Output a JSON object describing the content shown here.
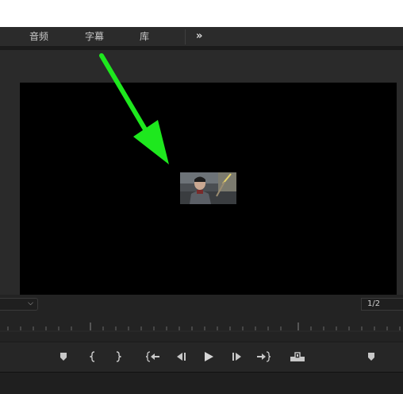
{
  "tabs": [
    {
      "label": "音频"
    },
    {
      "label": "字幕"
    },
    {
      "label": "库"
    }
  ],
  "overflow_label": "»",
  "monitor": {
    "page_indicator": "1/2"
  },
  "colors": {
    "annotation_arrow": "#1ee81e",
    "panel_bg": "#232323",
    "tab_text": "#c9c9c9"
  },
  "controls": [
    {
      "name": "add-marker",
      "icon": "marker-icon"
    },
    {
      "name": "mark-in",
      "icon": "mark-in-icon"
    },
    {
      "name": "mark-out",
      "icon": "mark-out-icon"
    },
    {
      "name": "go-to-in",
      "icon": "go-to-in-icon"
    },
    {
      "name": "step-back",
      "icon": "step-back-icon"
    },
    {
      "name": "play",
      "icon": "play-icon"
    },
    {
      "name": "step-forward",
      "icon": "step-forward-icon"
    },
    {
      "name": "go-to-out",
      "icon": "go-to-out-icon"
    },
    {
      "name": "insert",
      "icon": "insert-icon"
    },
    {
      "name": "button-editor",
      "icon": "marker-icon"
    }
  ]
}
